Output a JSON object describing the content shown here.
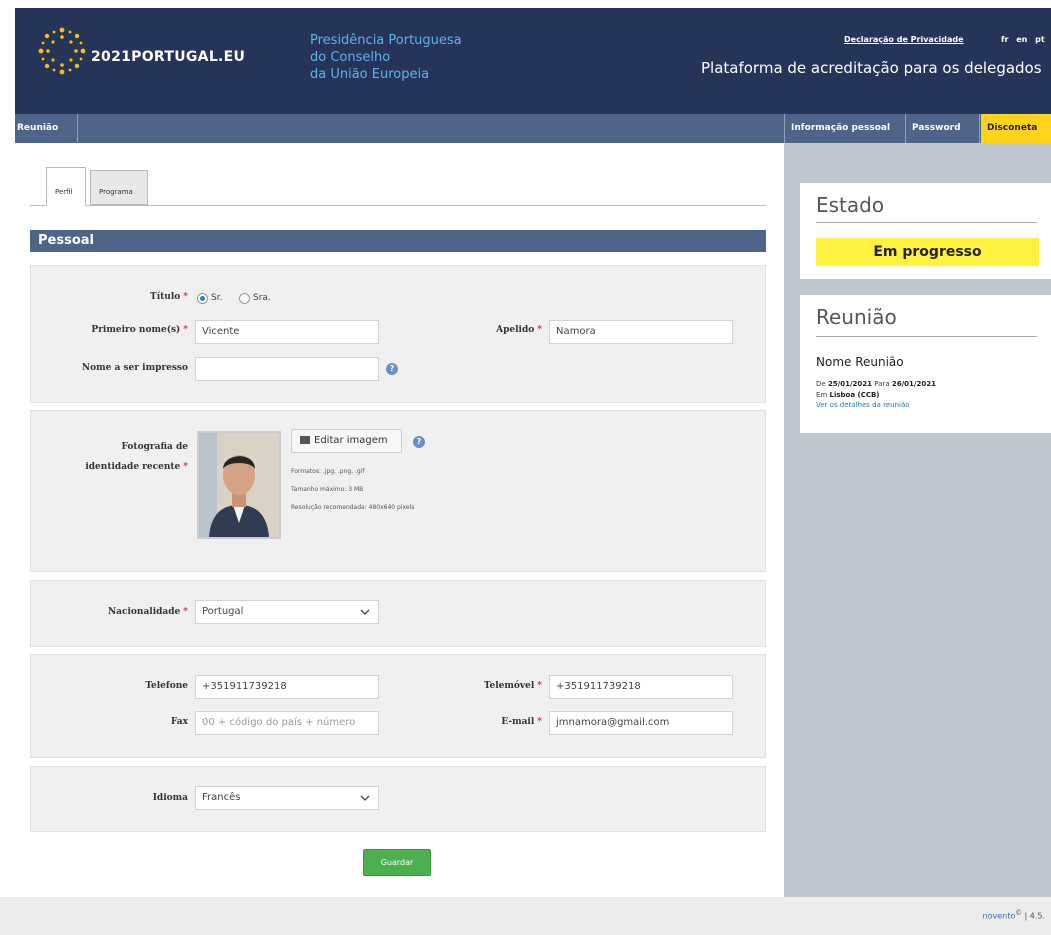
{
  "header": {
    "logo_text": "2021PORTUGAL.EU",
    "presidency_lines": [
      "Presidência Portuguesa",
      "do Conselho",
      "da União Europeia"
    ],
    "privacy_link": "Declaração de Privacidade",
    "languages": [
      "fr",
      "en",
      "pt"
    ],
    "platform_title": "Plataforma de acreditação para os delegados"
  },
  "nav": {
    "meeting": "Reunião",
    "personal_info": "Informação pessoal",
    "password": "Password",
    "logout": "Disconeta"
  },
  "tabs": [
    {
      "label": "Perfil",
      "active": true
    },
    {
      "label": "Programa",
      "active": false
    }
  ],
  "section": {
    "title": "Pessoal"
  },
  "form": {
    "title_label": "Título",
    "title_options": [
      {
        "label": "Sr.",
        "selected": true
      },
      {
        "label": "Sra.",
        "selected": false
      }
    ],
    "first_name_label": "Primeiro nome(s)",
    "first_name_value": "Vicente",
    "last_name_label": "Apelido",
    "last_name_value": "Namora",
    "print_name_label": "Nome a ser impresso",
    "print_name_value": "",
    "photo_label_line1": "Fotografia de",
    "photo_label_line2": "identidade recente",
    "edit_image_button": "Editar imagem",
    "photo_info": [
      "Formatos: .jpg, .png, .gif",
      "Tamanho máximo: 3 MB",
      "Resolução recomendada: 480x640 pixels"
    ],
    "nationality_label": "Nacionalidade",
    "nationality_value": "Portugal",
    "phone_label": "Telefone",
    "phone_value": "+351911739218",
    "mobile_label": "Telemóvel",
    "mobile_value": "+351911739218",
    "fax_label": "Fax",
    "fax_placeholder": "00 + código do país + número",
    "email_label": "E-mail",
    "email_value": "jmnamora@gmail.com",
    "language_label": "Idioma",
    "language_value": "Francês",
    "save_button": "Guardar"
  },
  "sidebar": {
    "status_title": "Estado",
    "status_value": "Em progresso",
    "meeting_title": "Reunião",
    "meeting_name": "Nome Reunião",
    "date_from_label": "De",
    "date_from": "25/01/2021",
    "date_to_label": "Para",
    "date_to": "26/01/2021",
    "location_label": "Em",
    "location": "Lisboa (CCB)",
    "details_link": "Ver os detalhes da reunião"
  },
  "footer": {
    "brand": "novento",
    "copyright_symbol": "©",
    "version": "| 4.5."
  },
  "colors": {
    "header_bg": "#273459",
    "nav_bg": "#4e6488",
    "accent_yellow": "#ffd31a",
    "status_yellow": "#fff13e",
    "save_green": "#4cb04f",
    "required_red": "#d9302c",
    "sidebar_bg": "#bfc8d0"
  }
}
